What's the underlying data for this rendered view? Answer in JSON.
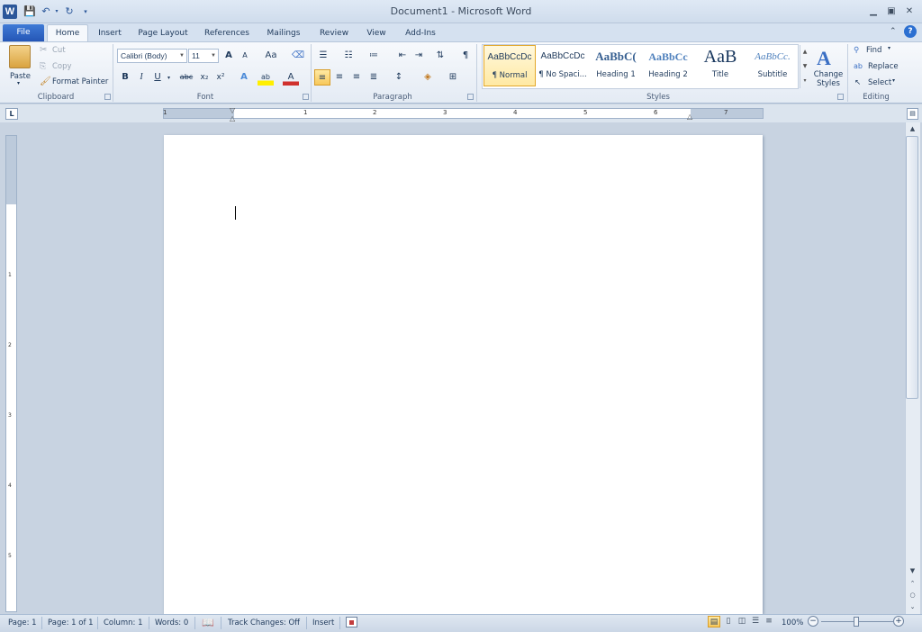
{
  "window": {
    "title": "Document1  -  Microsoft Word",
    "logo_letter": "W"
  },
  "qat": {
    "save_icon": "save-icon",
    "undo_icon": "undo-icon",
    "redo_icon": "redo-icon",
    "customize_icon": "customize-qat-icon"
  },
  "window_controls": {
    "minimize": "▭",
    "restore": "▣",
    "close": "✕"
  },
  "tabs": [
    {
      "label": "File"
    },
    {
      "label": "Home"
    },
    {
      "label": "Insert"
    },
    {
      "label": "Page Layout"
    },
    {
      "label": "References"
    },
    {
      "label": "Mailings"
    },
    {
      "label": "Review"
    },
    {
      "label": "View"
    },
    {
      "label": "Add-Ins"
    }
  ],
  "clipboard": {
    "group": "Clipboard",
    "paste": "Paste",
    "cut": "Cut",
    "copy": "Copy",
    "format_painter": "Format Painter"
  },
  "font": {
    "group": "Font",
    "name": "Calibri (Body)",
    "size": "11",
    "grow": "A",
    "shrink": "A",
    "change_case": "Aa",
    "bold": "B",
    "italic": "I",
    "underline": "U",
    "strike": "abc",
    "subscript": "x₂",
    "superscript": "x²",
    "effects": "A",
    "highlight": "ab",
    "color": "A"
  },
  "paragraph": {
    "group": "Paragraph",
    "show_marks": "¶"
  },
  "styles": {
    "group": "Styles",
    "items": [
      {
        "preview": "AaBbCcDc",
        "name": "¶ Normal"
      },
      {
        "preview": "AaBbCcDc",
        "name": "¶ No Spaci..."
      },
      {
        "preview": "AaBbC(",
        "name": "Heading 1"
      },
      {
        "preview": "AaBbCc",
        "name": "Heading 2"
      },
      {
        "preview": "AaB",
        "name": "Title"
      },
      {
        "preview": "AaBbCc.",
        "name": "Subtitle"
      }
    ],
    "change_styles": "Change Styles"
  },
  "editing": {
    "group": "Editing",
    "find": "Find",
    "replace": "Replace",
    "select": "Select"
  },
  "ruler": {
    "tab_selector": "L",
    "numbers": [
      "1",
      "1",
      "2",
      "3",
      "4",
      "5",
      "6",
      "7"
    ],
    "vnumbers": [
      "1",
      "2",
      "3",
      "4",
      "5"
    ]
  },
  "status": {
    "page": "Page: 1",
    "pages": "Page: 1 of 1",
    "column": "Column: 1",
    "words": "Words: 0",
    "track": "Track Changes: Off",
    "mode": "Insert",
    "zoom": "100%"
  },
  "colors": {
    "file_tab": "#2b579a",
    "accent": "#1e395b",
    "highlight": "#ffe9a3"
  }
}
